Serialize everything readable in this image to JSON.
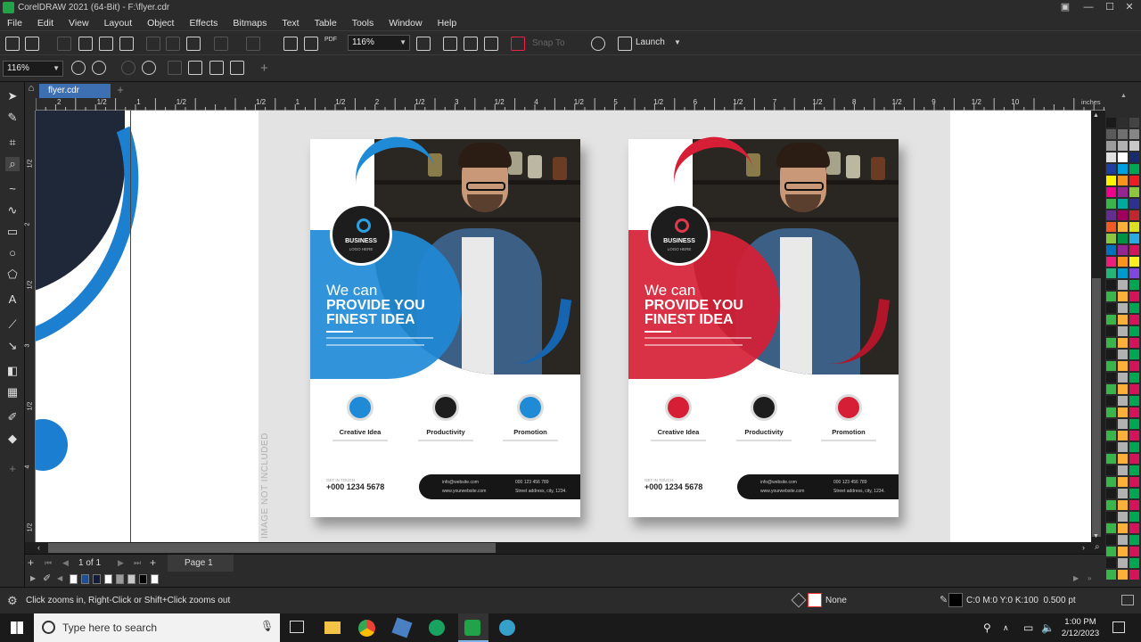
{
  "window": {
    "title": "CorelDRAW 2021 (64-Bit) - F:\\flyer.cdr",
    "min": "—",
    "max": "☐",
    "close": "✕",
    "restore": "▣"
  },
  "menu": [
    "File",
    "Edit",
    "View",
    "Layout",
    "Object",
    "Effects",
    "Bitmaps",
    "Text",
    "Table",
    "Tools",
    "Window",
    "Help"
  ],
  "toolbar1": {
    "zoom_value": "116%",
    "snap_to": "Snap To",
    "launch": "Launch",
    "pdf": "PDF"
  },
  "toolbar2": {
    "zoom_value": "116%"
  },
  "doc_tab": {
    "label": "flyer.cdr",
    "add": "+"
  },
  "ruler": {
    "units": "inches",
    "labels": [
      "2",
      "1/2",
      "1",
      "1/2",
      "",
      "1/2",
      "1",
      "1/2",
      "2",
      "1/2",
      "3",
      "1/2",
      "4",
      "1/2",
      "5",
      "1/2",
      "6",
      "1/2",
      "7",
      "1/2",
      "8",
      "1/2",
      "9",
      "1/2",
      "10"
    ],
    "v_labels": [
      "1/2",
      "2",
      "1/2",
      "3",
      "1/2",
      "4",
      "1/2"
    ]
  },
  "watermark": "IMAGE NOT INCLUDED",
  "flyers": [
    {
      "accent": "#1f8ad6",
      "accent_dark": "#1565b0",
      "logo_title": "BUSINESS",
      "logo_sub": "LOGO HERE",
      "headline_small": "We can",
      "headline_1": "PROVIDE YOU",
      "headline_2": "FINEST IDEA",
      "features": [
        "Creative Idea",
        "Productivity",
        "Promotion"
      ],
      "contact_label": "GET IN TOUCH",
      "phone": "+000 1234 5678",
      "email": "info@website.com",
      "web": "www.yourwebsite.com",
      "tel2": "000 123 456 789",
      "address": "Street address, city, 1234."
    },
    {
      "accent": "#d61f36",
      "accent_dark": "#b0152a",
      "logo_title": "BUSINESS",
      "logo_sub": "LOGO HERE",
      "headline_small": "We can",
      "headline_1": "PROVIDE YOU",
      "headline_2": "FINEST IDEA",
      "features": [
        "Creative Idea",
        "Productivity",
        "Promotion"
      ],
      "contact_label": "GET IN TOUCH",
      "phone": "+000 1234 5678",
      "email": "info@website.com",
      "web": "www.yourwebsite.com",
      "tel2": "000 123 456 789",
      "address": "Street address, city, 1234."
    }
  ],
  "page_nav": {
    "counter": "1 of 1",
    "page_tab": "Page 1",
    "add": "+"
  },
  "status": {
    "hint": "Click zooms in, Right-Click or Shift+Click zooms out",
    "fill": "None",
    "outline": "C:0 M:0 Y:0 K:100  0.500 pt"
  },
  "taskbar": {
    "search_placeholder": "Type here to search",
    "time": "1:00 PM",
    "date": "2/12/2023"
  },
  "palette_colors": [
    "#1a1a1a",
    "#2e2e2e",
    "#444",
    "#5a5a5a",
    "#707070",
    "#868686",
    "#9c9c9c",
    "#b2b2b2",
    "#c8c8c8",
    "#e0e0e0",
    "#fff",
    "#1a2b6d",
    "#1f3fa0",
    "#00a0e0",
    "#00a651",
    "#fff200",
    "#f7941d",
    "#ed1c24",
    "#ec008c",
    "#92278f",
    "#8dc63f",
    "#39b54a",
    "#00a99d",
    "#2e3192",
    "#662d91",
    "#9e005d",
    "#c1272d",
    "#f15a24",
    "#fbb03b",
    "#d9e021",
    "#8cc63f",
    "#009245",
    "#29abe2",
    "#0071bc",
    "#93278f",
    "#d4145a",
    "#ed1e79",
    "#f7931e",
    "#fcee21",
    "#22b573",
    "#0099cc",
    "#7f47dd"
  ],
  "swatches": [
    "#ffffff",
    "#1f4f8f",
    "#111a3a",
    "#ffffff",
    "#9a9a9a",
    "#c9c9c9",
    "#000000",
    "#ffffff"
  ],
  "colors": {
    "chrome": "#2b2b2b",
    "tab_active": "#3d6fb3",
    "canvas_gray": "#e3e3e3"
  }
}
